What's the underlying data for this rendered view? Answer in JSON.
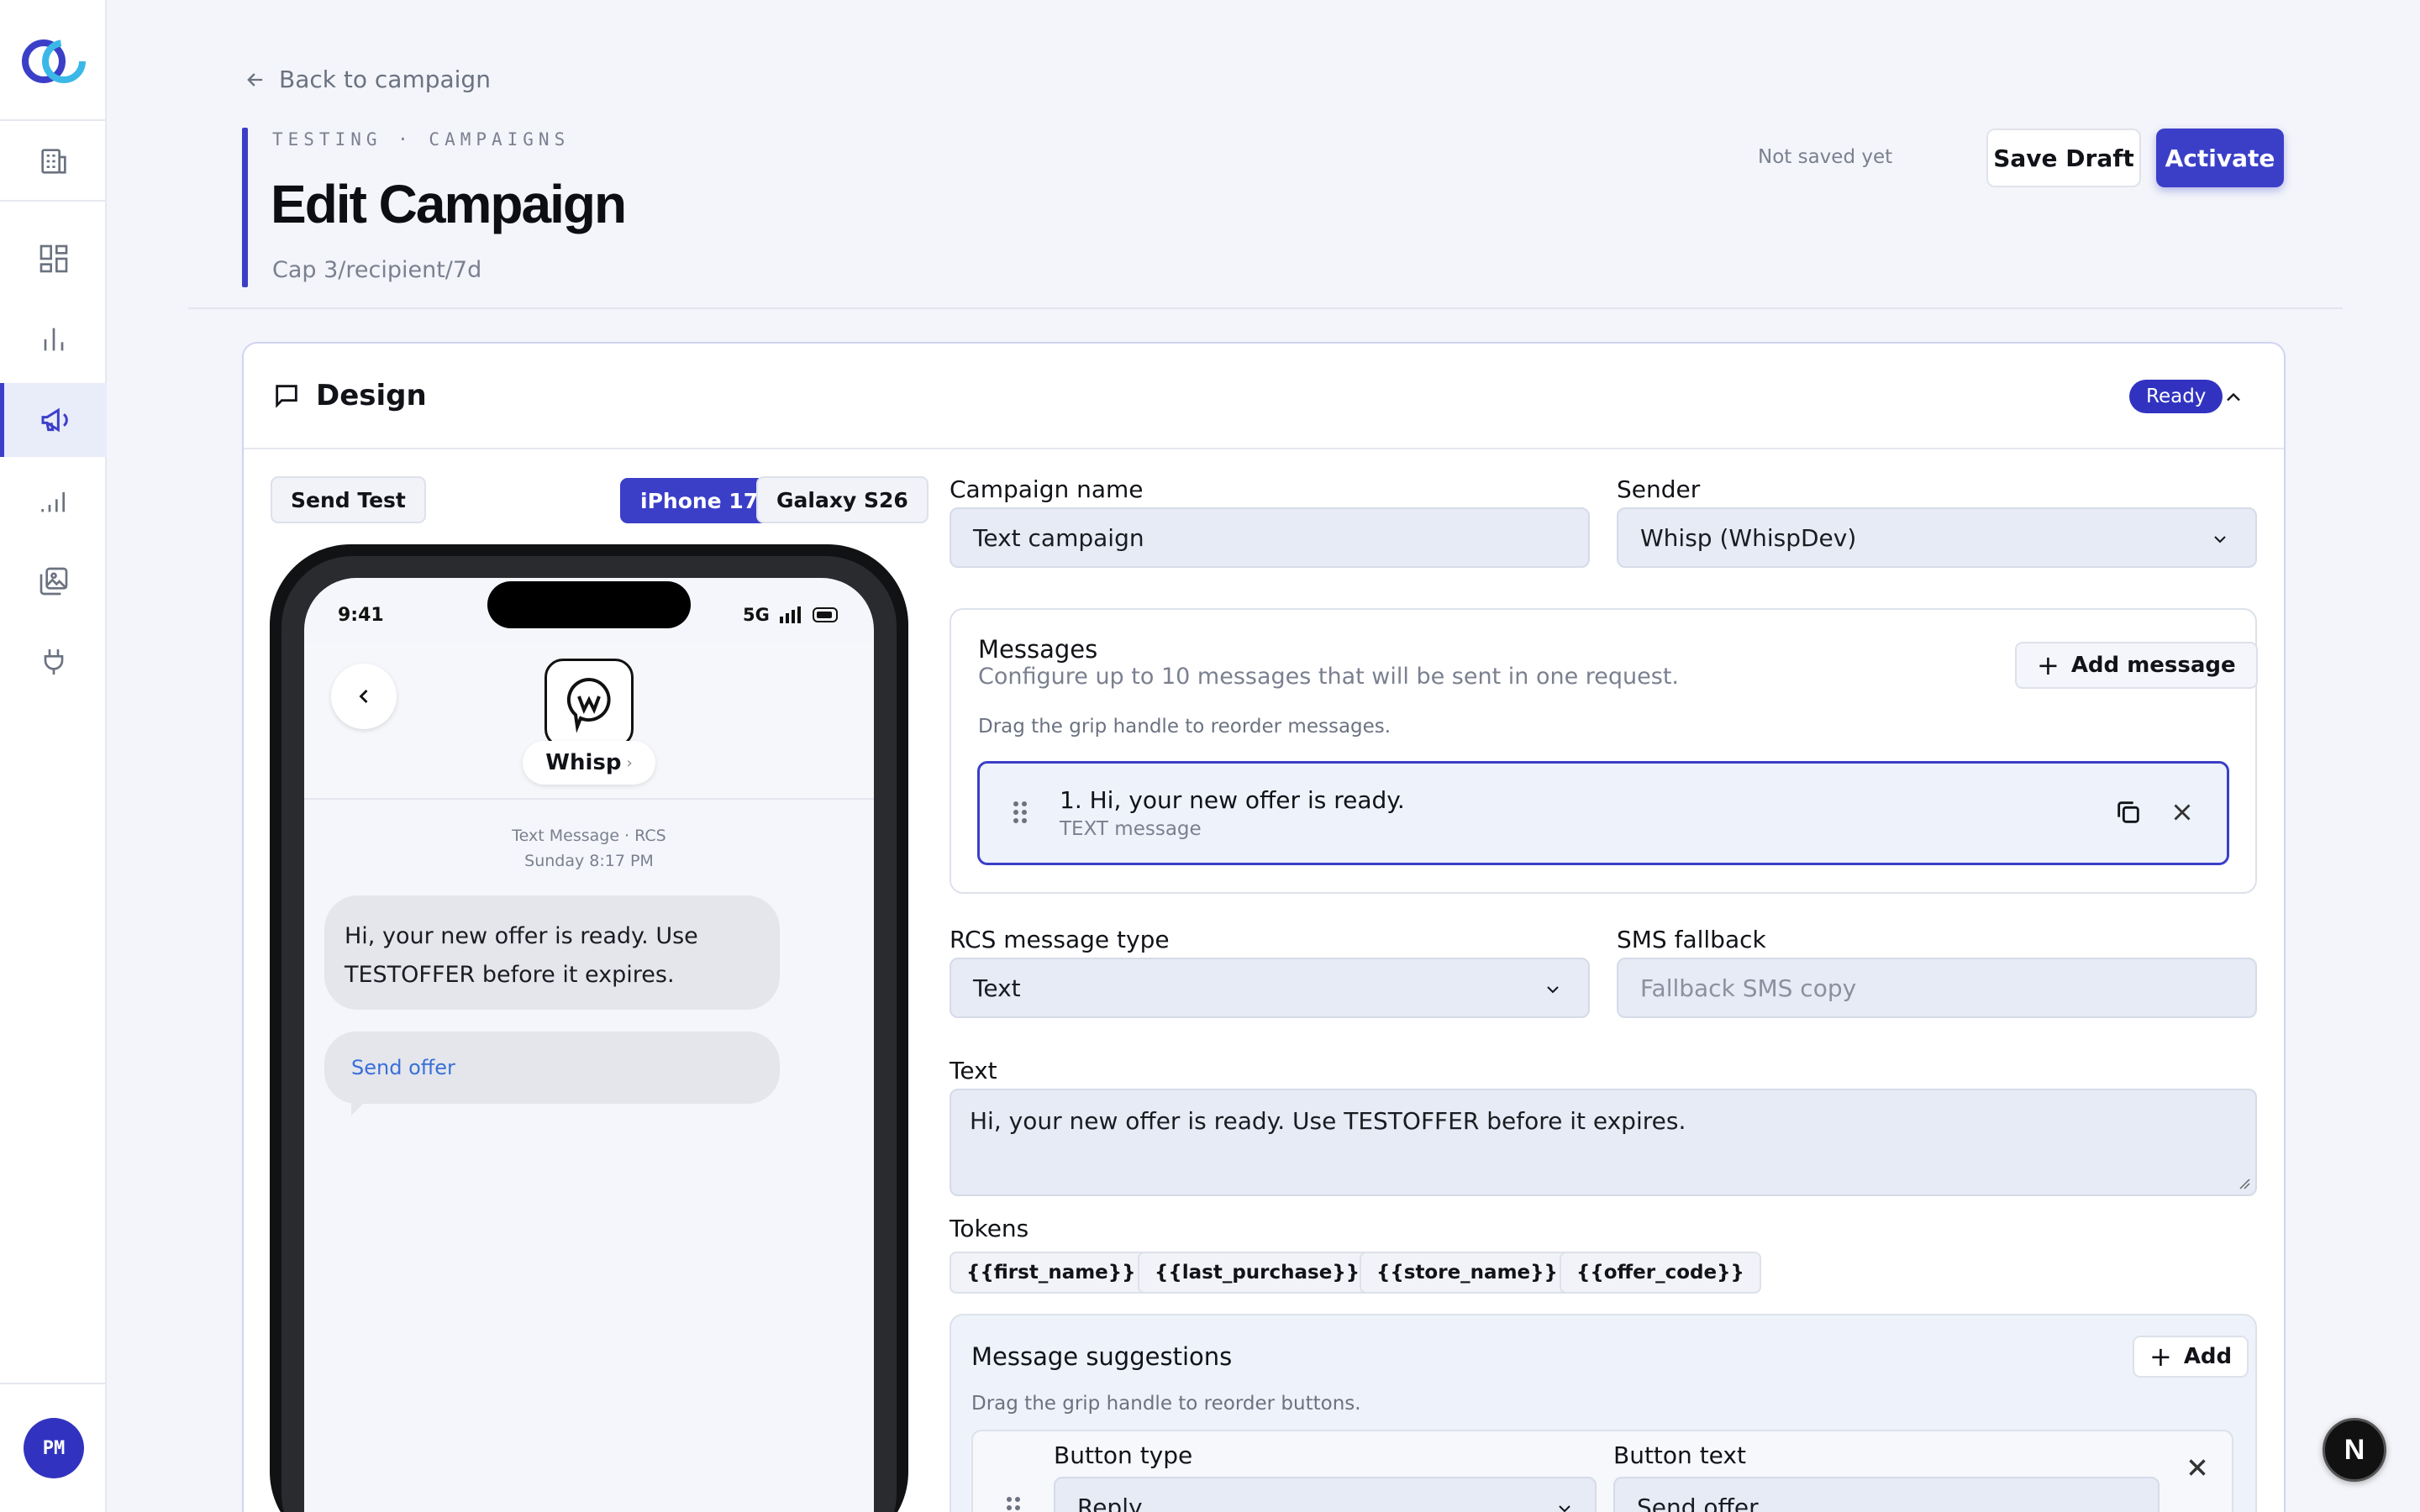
{
  "header": {
    "back_link": "Back to campaign",
    "eyebrow": "TESTING · CAMPAIGNS",
    "title": "Edit Campaign",
    "subtitle": "Cap 3/recipient/7d",
    "save_status": "Not saved yet",
    "save_draft": "Save Draft",
    "activate": "Activate"
  },
  "sidebar": {
    "items": [
      "building-icon",
      "dashboard-icon",
      "bar-chart-icon",
      "megaphone-icon",
      "signal-icon",
      "image-gallery-icon",
      "plug-icon"
    ],
    "active": "megaphone-icon",
    "avatar": "PM"
  },
  "design": {
    "title": "Design",
    "status": "Ready",
    "send_test": "Send Test",
    "devices": [
      "iPhone 17",
      "Galaxy S26"
    ],
    "selected_device": "iPhone 17"
  },
  "phone": {
    "time": "9:41",
    "network": "5G",
    "brand": "Whisp",
    "brand_chevron": "›",
    "meta_line1": "Text Message · RCS",
    "meta_line2": "Sunday 8:17 PM",
    "bubble_text": "Hi, your new offer is ready. Use TESTOFFER before it expires.",
    "suggestion": "Send offer"
  },
  "form": {
    "campaign_name_label": "Campaign name",
    "campaign_name": "Text campaign",
    "sender_label": "Sender",
    "sender": "Whisp (WhispDev)",
    "messages": {
      "title": "Messages",
      "description": "Configure up to 10 messages that will be sent in one request.",
      "hint": "Drag the grip handle to reorder messages.",
      "add_label": "Add message",
      "items": [
        {
          "title": "1. Hi, your new offer is ready.",
          "type": "TEXT message"
        }
      ]
    },
    "rcs_type_label": "RCS message type",
    "rcs_type": "Text",
    "sms_fallback_label": "SMS fallback",
    "sms_fallback_placeholder": "Fallback SMS copy",
    "text_label": "Text",
    "text_value": "Hi, your new offer is ready. Use TESTOFFER before it expires.",
    "tokens_label": "Tokens",
    "tokens": [
      "{{first_name}}",
      "{{last_purchase}}",
      "{{store_name}}",
      "{{offer_code}}"
    ],
    "suggestions": {
      "title": "Message suggestions",
      "add_label": "Add",
      "hint": "Drag the grip handle to reorder buttons.",
      "button_type_label": "Button type",
      "button_type": "Reply",
      "button_text_label": "Button text",
      "button_text": "Send offer"
    }
  },
  "colors": {
    "accent": "#3b3fc8",
    "background": "#f3f5fa",
    "input_bg": "#e6ebf5"
  },
  "floating_badge": "N"
}
